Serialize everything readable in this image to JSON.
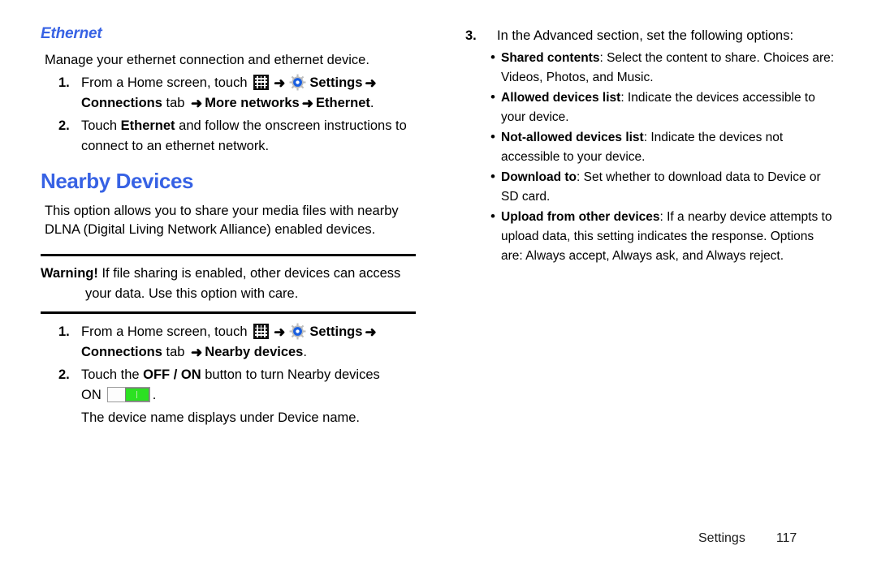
{
  "left_column": {
    "section_heading": "Ethernet",
    "intro": "Manage your ethernet connection and ethernet device.",
    "ethernet_steps": [
      {
        "num": "1.",
        "prefix": "From a Home screen, touch ",
        "apps_icon": "apps-grid-icon",
        "arrow1": "➜",
        "gear_icon": "settings-gear-icon",
        "settings_label": "Settings",
        "arrow2": "➜",
        "tab_label": "Connections",
        "tab_word": " tab ",
        "arrow3": "➜",
        "target1": "More networks",
        "arrow4": "➜",
        "target2": "Ethernet",
        "end": "."
      },
      {
        "num": "2.",
        "text_before": "Touch ",
        "bold": "Ethernet",
        "text_after": " and follow the onscreen instructions to connect to an ethernet network."
      }
    ],
    "main_heading": "Nearby Devices",
    "nearby_intro": "This option allows you to share your media files with nearby DLNA (Digital Living Network Alliance) enabled devices.",
    "warning": {
      "label": "Warning!",
      "line1": " If file sharing is enabled, other devices can access",
      "line2": "your data. Use this option with care."
    },
    "nearby_steps": [
      {
        "num": "1.",
        "prefix": "From a Home screen, touch ",
        "apps_icon": "apps-grid-icon",
        "arrow1": "➜",
        "gear_icon": "settings-gear-icon",
        "settings_label": "Settings",
        "arrow2": "➜",
        "tab_label": "Connections",
        "tab_word": " tab ",
        "arrow3": "➜",
        "target1": "Nearby devices",
        "end": "."
      },
      {
        "num": "2.",
        "text_before": "Touch the ",
        "bold": "OFF / ON",
        "text_after": " button to turn Nearby devices",
        "on_label": "ON",
        "toggle_icon": "on-off-toggle-switch",
        "period": ".",
        "follow_up": "The device name displays under Device name."
      }
    ]
  },
  "right_column": {
    "step": {
      "num": "3.",
      "text": "In the Advanced section, set the following options:"
    },
    "bullets": [
      {
        "term": "Shared contents",
        "desc": ": Select the content to share. Choices are: Videos, Photos, and Music."
      },
      {
        "term": "Allowed devices list",
        "desc": ": Indicate the devices accessible to your device."
      },
      {
        "term": "Not-allowed devices list",
        "desc": ": Indicate the devices not accessible to your device."
      },
      {
        "term": "Download to",
        "desc": ": Set whether to download data to Device or SD card."
      },
      {
        "term": "Upload from other devices",
        "desc": ": If a nearby device attempts to upload data, this setting indicates the response. Options are: Always accept, Always ask, and Always reject."
      }
    ]
  },
  "footer": {
    "label": "Settings",
    "page_number": "117"
  },
  "colors": {
    "heading_blue": "#3762E4",
    "toggle_green": "#2CE122",
    "gear_blue": "#1A5FE0",
    "text_black": "#000000"
  }
}
